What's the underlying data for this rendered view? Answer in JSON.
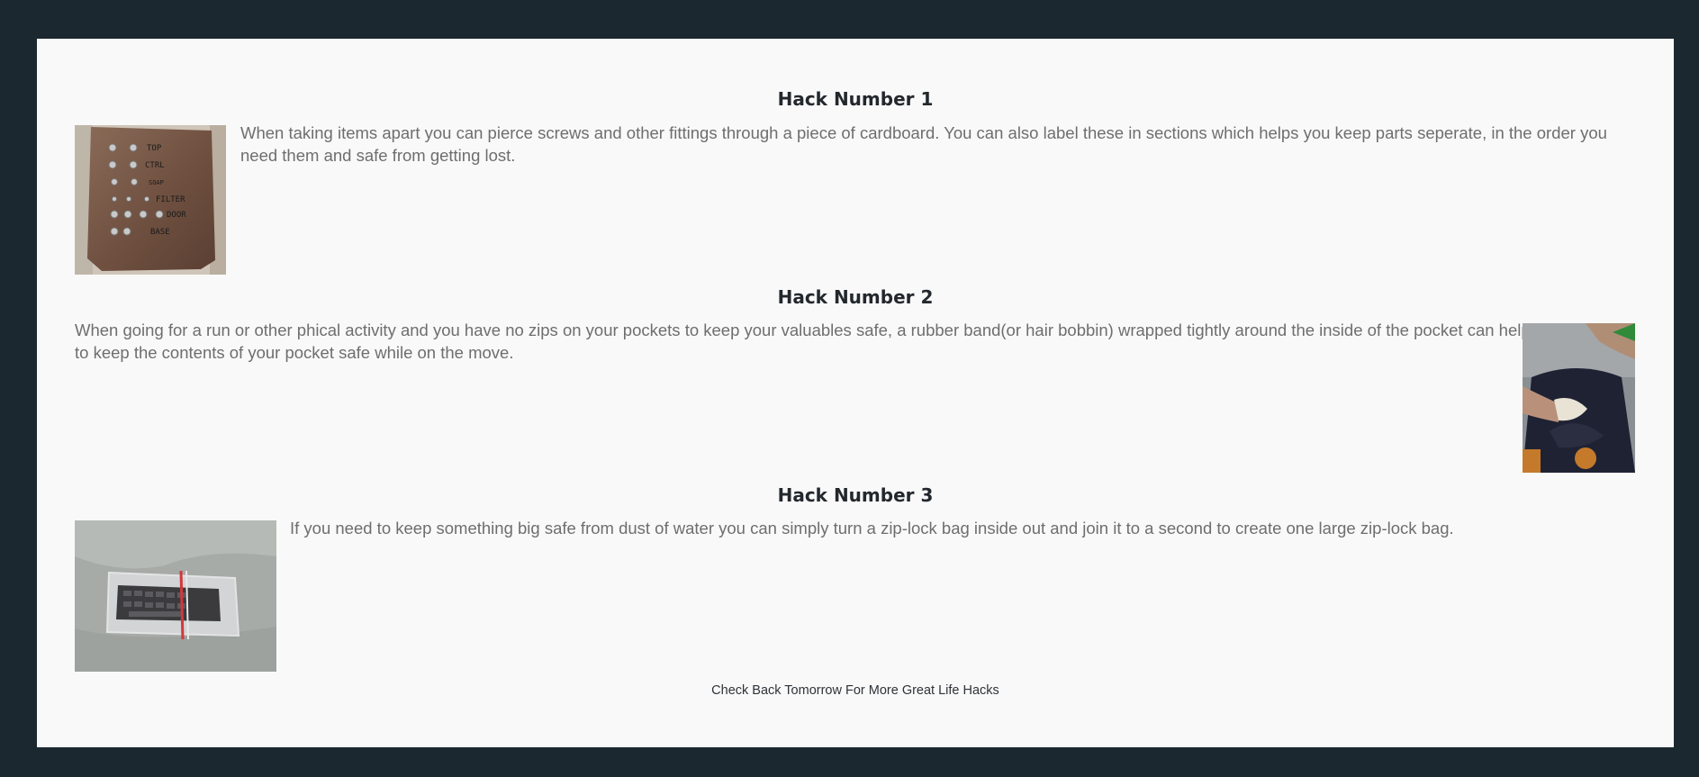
{
  "hacks": [
    {
      "title": "Hack Number 1",
      "text": "When taking items apart you can pierce screws and other fittings through a piece of cardboard. You can also label these in sections which helps you keep parts seperate, in the order you need them and safe from getting lost.",
      "image_labels": [
        "TOP",
        "CTRL",
        "SOAP",
        "FILTER",
        "DOOR",
        "BASE"
      ]
    },
    {
      "title": "Hack Number 2",
      "text": "When going for a run or other phical activity and you have no zips on your pockets to keep your valuables safe, a rubber band(or hair bobbin) wrapped tightly around the inside of the pocket can help to keep the contents of your pocket safe while on the move."
    },
    {
      "title": "Hack Number 3",
      "text": "If you need to keep something big safe from dust of water you can simply turn a zip-lock bag inside out and join it to a second to create one large zip-lock bag."
    }
  ],
  "footer": {
    "note": "Check Back Tomorrow For More Great Life Hacks"
  },
  "colors": {
    "outer_background": "#1b2830",
    "content_background": "#f9f9f9",
    "heading": "#23282d",
    "body_text": "#6e6e6e"
  }
}
